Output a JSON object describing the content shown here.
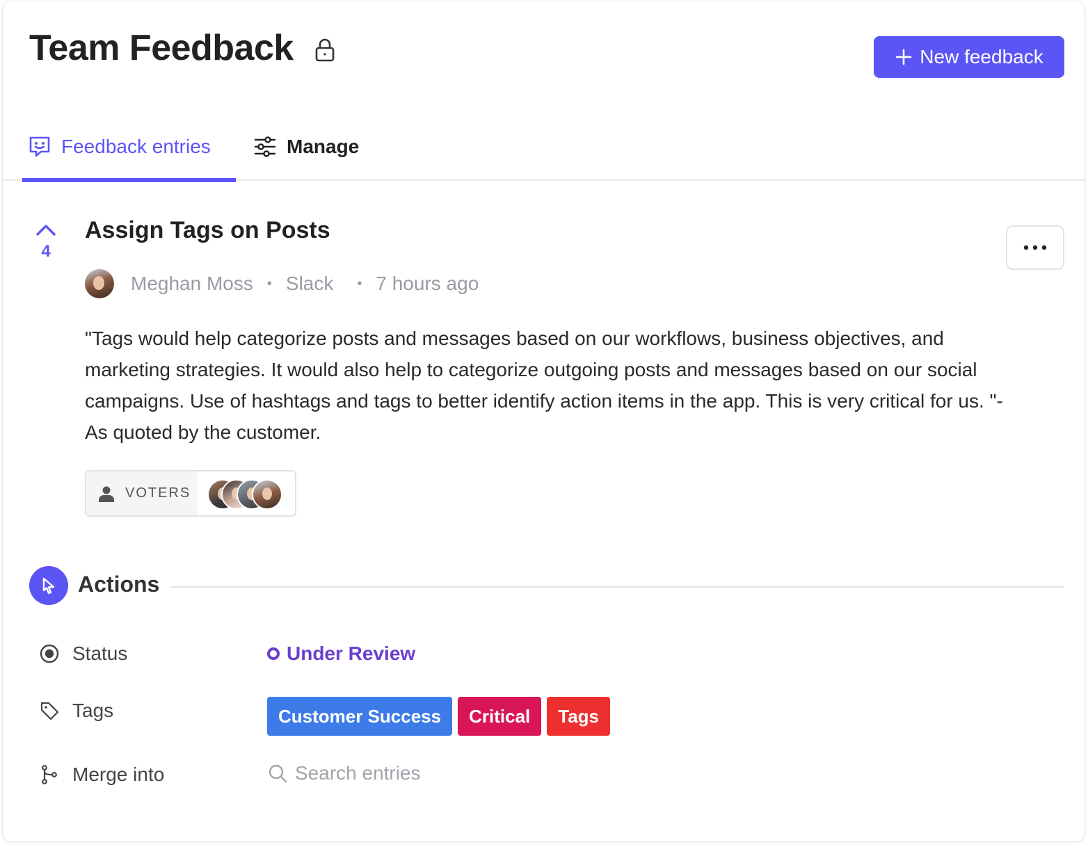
{
  "header": {
    "title": "Team Feedback",
    "new_button_label": "New feedback"
  },
  "tabs": [
    {
      "label": "Feedback entries",
      "active": true
    },
    {
      "label": "Manage",
      "active": false
    }
  ],
  "entry": {
    "votes": "4",
    "title": "Assign Tags on Posts",
    "author": "Meghan Moss",
    "source": "Slack",
    "time": "7 hours ago",
    "body": "\"Tags would help categorize posts and messages based on our workflows, business objectives, and marketing strategies. It would also help to categorize outgoing posts and messages based on our social campaigns. Use of hashtags and tags to better identify action items in the app. This is very critical for us. \"- As quoted by the customer.",
    "voters_label": "VOTERS"
  },
  "actions": {
    "title": "Actions",
    "status_label": "Status",
    "status_value": "Under Review",
    "tags_label": "Tags",
    "tags": [
      {
        "label": "Customer Success",
        "color": "#3d7be8"
      },
      {
        "label": "Critical",
        "color": "#d91557"
      },
      {
        "label": "Tags",
        "color": "#ee2f2f"
      }
    ],
    "merge_label": "Merge into",
    "merge_placeholder": "Search entries"
  },
  "colors": {
    "accent": "#5b55f5",
    "status": "#6a3fcf"
  },
  "icons": {
    "title_lock": "lock-icon",
    "new_button": "plus-icon",
    "tab_feedback": "chat-smile-icon",
    "tab_manage": "sliders-icon",
    "upvote": "chevron-up-icon",
    "more": "ellipsis-icon",
    "voters": "user-icon",
    "actions": "cursor-icon",
    "status": "radio-target-icon",
    "tags": "tag-icon",
    "merge": "git-branch-icon",
    "search": "search-icon"
  }
}
